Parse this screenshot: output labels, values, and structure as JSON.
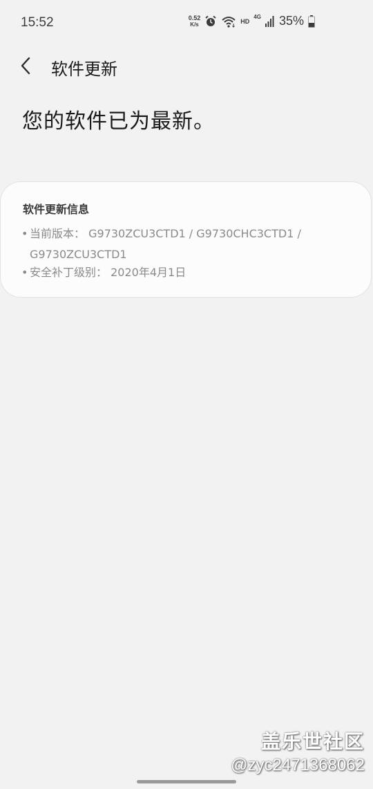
{
  "status_bar": {
    "time": "15:52",
    "net_speed_value": "0.52",
    "net_speed_unit": "K/s",
    "hd": "HD",
    "network": "4G",
    "battery": "35%",
    "icons": [
      "alarm-icon",
      "wifi-icon",
      "signal-icon",
      "battery-icon"
    ]
  },
  "header": {
    "back_icon": "chevron-left-icon",
    "title": "软件更新"
  },
  "main": {
    "message": "您的软件已为最新。"
  },
  "info_card": {
    "title": "软件更新信息",
    "version_label": "当前版本：",
    "version_value_line1": "G9730ZCU3CTD1 / G9730CHC3CTD1 /",
    "version_value_line2": "G9730ZCU3CTD1",
    "security_label": "安全补丁级别：",
    "security_value": "2020年4月1日"
  },
  "watermark": {
    "logo": "盖乐世社区",
    "user": "@zyc2471368062"
  },
  "colors": {
    "background": "#f2f2f2",
    "card": "#fcfcfc",
    "secondary_text": "#8a8a8a"
  }
}
